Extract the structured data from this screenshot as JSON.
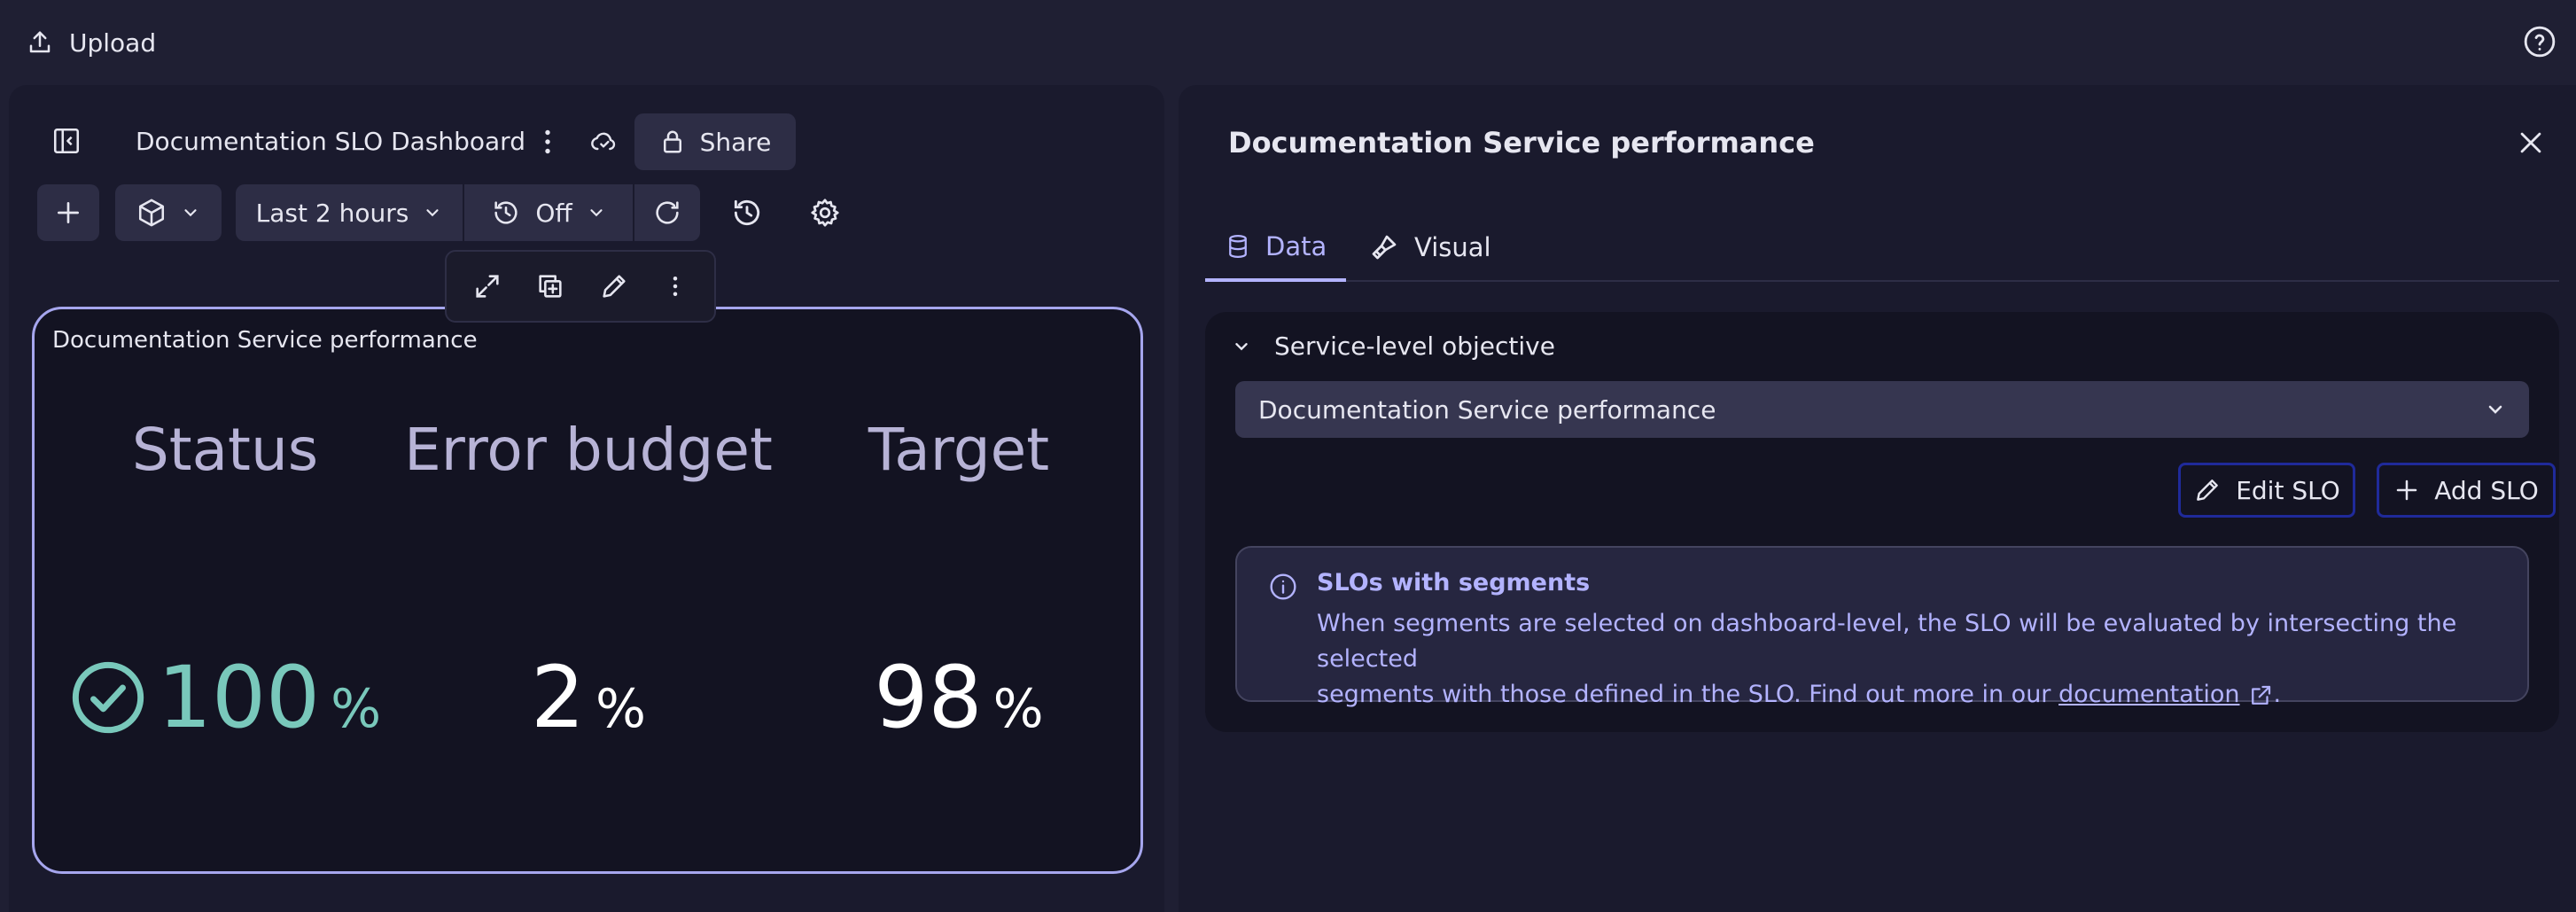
{
  "topbar": {
    "upload_label": "Upload"
  },
  "dashboard": {
    "title": "Documentation SLO Dashboard",
    "share_label": "Share",
    "timeframe_label": "Last 2 hours",
    "refresh_label": "Off"
  },
  "tile": {
    "title": "Documentation Service performance",
    "metrics": [
      {
        "label": "Status",
        "value": "100",
        "unit": "%",
        "color": "#79c8bb"
      },
      {
        "label": "Error budget",
        "value": "2",
        "unit": "%",
        "color": "#ffffff"
      },
      {
        "label": "Target",
        "value": "98",
        "unit": "%",
        "color": "#ffffff"
      }
    ]
  },
  "panel": {
    "title": "Documentation Service performance",
    "tabs": [
      {
        "label": "Data",
        "active": true
      },
      {
        "label": "Visual",
        "active": false
      }
    ],
    "section_title": "Service-level objective",
    "selected_slo": "Documentation Service performance",
    "edit_label": "Edit SLO",
    "add_label": "Add SLO",
    "info": {
      "title": "SLOs with segments",
      "text_line1": "When segments are selected on dashboard-level, the SLO will be evaluated by intersecting the selected",
      "text_line2_prefix": "segments with those defined in the SLO. Find out more in our ",
      "link_text": "documentation",
      "text_suffix": "."
    }
  },
  "colors": {
    "accent": "#b3b3ff",
    "success": "#79c8bb",
    "tile_border": "#a6a6ee",
    "background": "#1f1f33"
  }
}
